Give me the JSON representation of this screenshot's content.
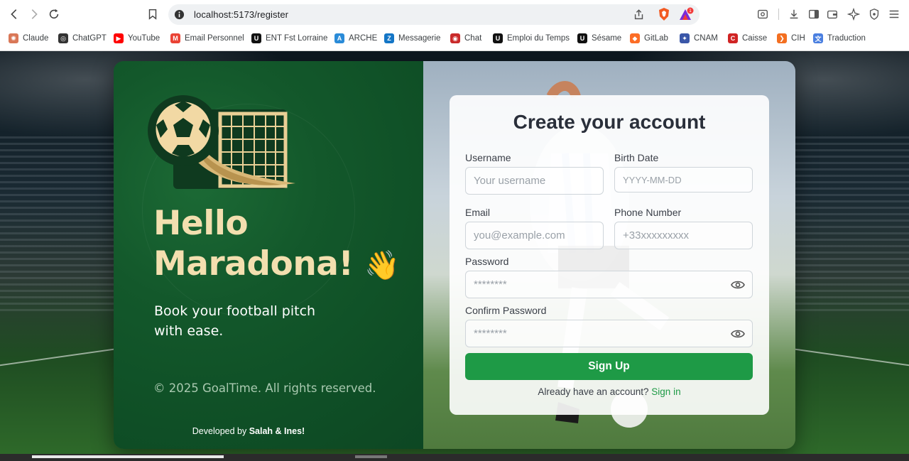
{
  "browser": {
    "url": "localhost:5173/register",
    "bookmarks": [
      {
        "label": "Claude",
        "icon": "claude-icon",
        "color": "#d97757"
      },
      {
        "label": "ChatGPT",
        "icon": "chatgpt-icon",
        "color": "#333333"
      },
      {
        "label": "YouTube",
        "icon": "youtube-icon",
        "color": "#ff0000"
      },
      {
        "label": "Email Personnel",
        "icon": "gmail-icon",
        "color": "#ea4335"
      },
      {
        "label": "ENT Fst Lorraine",
        "icon": "lorraine-icon",
        "color": "#111111"
      },
      {
        "label": "ARCHE",
        "icon": "arche-icon",
        "color": "#2a8bd8"
      },
      {
        "label": "Messagerie",
        "icon": "zimbra-icon",
        "color": "#1476c6"
      },
      {
        "label": "Chat",
        "icon": "chat-icon",
        "color": "#c92a2a"
      },
      {
        "label": "Emploi du Temps",
        "icon": "lorraine-icon",
        "color": "#111111"
      },
      {
        "label": "Sésame",
        "icon": "lorraine-icon",
        "color": "#111111"
      },
      {
        "label": "GitLab",
        "icon": "gitlab-icon",
        "color": "#fc6d26"
      },
      {
        "label": "CNAM",
        "icon": "cnam-icon",
        "color": "#3a57a8"
      },
      {
        "label": "Caisse",
        "icon": "caisse-icon",
        "color": "#d02424"
      },
      {
        "label": "CIH",
        "icon": "cih-icon",
        "color": "#f36f21"
      },
      {
        "label": "Traduction",
        "icon": "translate-icon",
        "color": "#4a7fe0"
      }
    ]
  },
  "hero": {
    "greeting_line1": "Hello",
    "greeting_line2": "Maradona!",
    "wave_emoji": "👋",
    "tagline": "Book your football pitch with ease.",
    "copyright": "© 2025 GoalTime. All rights reserved.",
    "developed_prefix": "Developed by",
    "developed_names": "Salah & Ines!"
  },
  "form": {
    "title": "Create your account",
    "username_label": "Username",
    "username_placeholder": "Your username",
    "birthdate_label": "Birth Date",
    "birthdate_placeholder": "YYYY-MM-DD",
    "email_label": "Email",
    "email_placeholder": "you@example.com",
    "phone_label": "Phone Number",
    "phone_placeholder": "+33xxxxxxxxx",
    "password_label": "Password",
    "password_placeholder": "********",
    "confirm_label": "Confirm Password",
    "confirm_placeholder": "********",
    "submit_label": "Sign Up",
    "signin_prompt": "Already have an account?",
    "signin_link": "Sign in"
  },
  "colors": {
    "brand_green": "#1e9a46",
    "panel_green": "#13582b",
    "accent_cream": "#f3dfaf"
  }
}
